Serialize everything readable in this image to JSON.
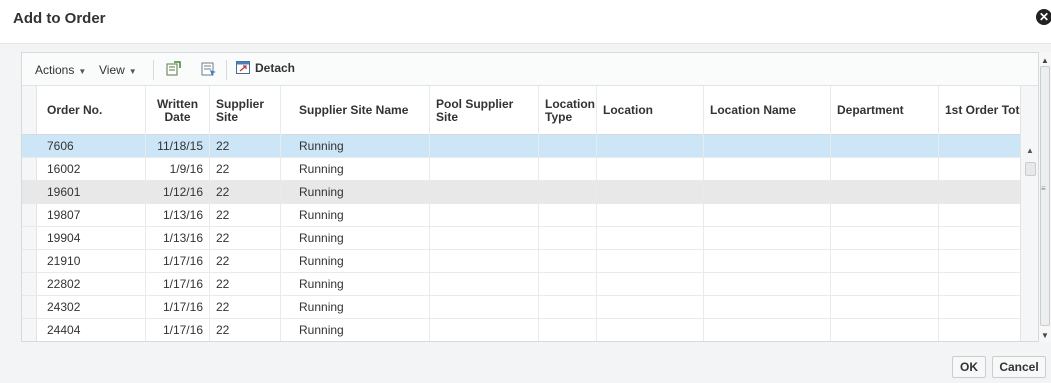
{
  "dialog": {
    "title": "Add to Order"
  },
  "toolbar": {
    "actions_label": "Actions",
    "view_label": "View",
    "detach_label": "Detach"
  },
  "grid": {
    "columns": [
      "Order No.",
      "Written Date",
      "Supplier Site",
      "Supplier Site Name",
      "Pool Supplier Site",
      "Location Type",
      "Location",
      "Location Name",
      "Department",
      "1st Order Tot"
    ],
    "rows": [
      [
        "7606",
        "11/18/15",
        "22",
        "Running",
        "",
        "",
        "",
        "",
        "",
        ""
      ],
      [
        "16002",
        "1/9/16",
        "22",
        "Running",
        "",
        "",
        "",
        "",
        "",
        ""
      ],
      [
        "19601",
        "1/12/16",
        "22",
        "Running",
        "",
        "",
        "",
        "",
        "",
        ""
      ],
      [
        "19807",
        "1/13/16",
        "22",
        "Running",
        "",
        "",
        "",
        "",
        "",
        ""
      ],
      [
        "19904",
        "1/13/16",
        "22",
        "Running",
        "",
        "",
        "",
        "",
        "",
        ""
      ],
      [
        "21910",
        "1/17/16",
        "22",
        "Running",
        "",
        "",
        "",
        "",
        "",
        ""
      ],
      [
        "22802",
        "1/17/16",
        "22",
        "Running",
        "",
        "",
        "",
        "",
        "",
        ""
      ],
      [
        "24302",
        "1/17/16",
        "22",
        "Running",
        "",
        "",
        "",
        "",
        "",
        ""
      ],
      [
        "24404",
        "1/17/16",
        "22",
        "Running",
        "",
        "",
        "",
        "",
        "",
        ""
      ]
    ],
    "selected_row": 0,
    "hover_row": 2
  },
  "footer": {
    "ok_label": "OK",
    "cancel_label": "Cancel"
  },
  "colors": {
    "selected_row": "#cde6f7",
    "hover_row": "#e8e8e8"
  }
}
